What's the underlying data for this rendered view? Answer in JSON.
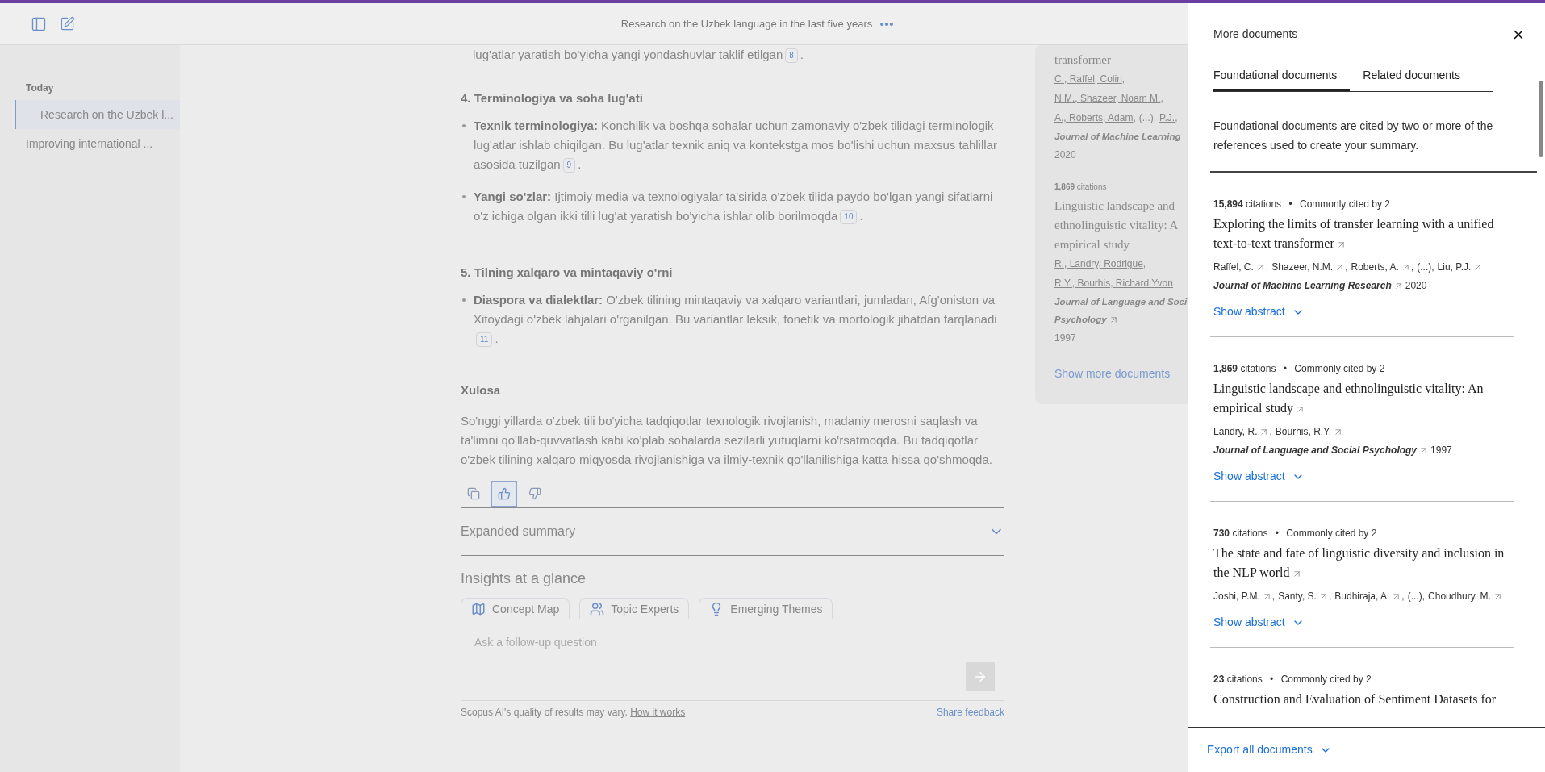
{
  "header": {
    "title": "Research on the Uzbek language in the last five years"
  },
  "sidebar": {
    "section": "Today",
    "items": [
      {
        "label": "Research on the Uzbek l...",
        "selected": true
      },
      {
        "label": "Improving international ...",
        "selected": false
      }
    ]
  },
  "content": {
    "intro": {
      "text": "lug'atlar yaratish bo'yicha yangi yondashuvlar taklif etilgan",
      "ref": "8",
      "end": "."
    },
    "sections": [
      {
        "heading": "4. Terminologiya va soha lug'ati",
        "bullets": [
          {
            "term": "Texnik terminologiya:",
            "text": "Konchilik va boshqa sohalar uchun zamonaviy o'zbek tilidagi terminologik lug'atlar ishlab chiqilgan. Bu lug'atlar texnik aniq va kontekstga mos bo'lishi uchun maxsus tahlillar asosida tuzilgan",
            "ref": "9",
            "end": "."
          },
          {
            "term": "Yangi so'zlar:",
            "text": "Ijtimoiy media va texnologiyalar ta'sirida o'zbek tilida paydo bo'lgan yangi sifatlarni o'z ichiga olgan ikki tilli lug'at yaratish bo'yicha ishlar olib borilmoqda",
            "ref": "10",
            "end": "."
          }
        ]
      },
      {
        "heading": "5. Tilning xalqaro va mintaqaviy o'rni",
        "bullets": [
          {
            "term": "Diaspora va dialektlar:",
            "text": "O'zbek tilining mintaqaviy va xalqaro variantlari, jumladan, Afg'oniston va Xitoydagi o'zbek lahjalari o'rganilgan. Bu variantlar leksik, fonetik va morfologik jihatdan farqlanadi",
            "ref": "11",
            "end": "."
          }
        ]
      }
    ],
    "conclusion": {
      "heading": "Xulosa",
      "text": "So'nggi yillarda o'zbek tili bo'yicha tadqiqotlar texnologik rivojlanish, madaniy merosni saqlash va ta'limni qo'llab-quvvatlash kabi ko'plab sohalarda sezilarli yutuqlarni ko'rsatmoqda. Bu tadqiqotlar o'zbek tilining xalqaro miqyosda rivojlanishiga va ilmiy-texnik qo'llanilishiga katta hissa qo'shmoqda."
    },
    "feedback": [
      {
        "kind": "copy",
        "selected": false
      },
      {
        "kind": "like",
        "selected": true
      },
      {
        "kind": "dislike",
        "selected": false
      }
    ],
    "expanded_summary": {
      "label": "Expanded summary",
      "expanded": false
    },
    "insights": {
      "title": "Insights at a glance",
      "tabs": [
        {
          "kind": "map",
          "label": "Concept Map"
        },
        {
          "kind": "experts",
          "label": "Topic Experts"
        },
        {
          "kind": "themes",
          "label": "Emerging Themes"
        }
      ]
    },
    "followup": {
      "placeholder": "Ask a follow-up question"
    },
    "footer": {
      "disclaimer": "Scopus AI's quality of results may vary.",
      "link": "How it works",
      "feedback": "Share feedback"
    }
  },
  "references": {
    "items": [
      {
        "title_lines": [
          "transformer"
        ],
        "author_lines": [
          [
            {
              "kind": "link",
              "text": "C., Raffel, Colin",
              "sep": ","
            }
          ],
          [
            {
              "kind": "link",
              "text": "N.M., Shazeer, Noam M.",
              "sep": ","
            }
          ],
          [
            {
              "kind": "link",
              "text": "A., Roberts, Adam",
              "sep": ","
            },
            {
              "kind": "text",
              "text": "(...)",
              "sep": ","
            },
            {
              "kind": "link",
              "text": "P.J.",
              "sep": ","
            }
          ]
        ],
        "journal_lines": [
          "Journal of Machine Learning"
        ],
        "year": "2020"
      },
      {
        "citations": "1,869",
        "citations_label": "citations",
        "title_lines": [
          "Linguistic landscape and",
          "ethnolinguistic vitality: A",
          "empirical study"
        ],
        "author_lines": [
          [
            {
              "kind": "link",
              "text": "R., Landry, Rodrigue",
              "sep": ","
            }
          ],
          [
            {
              "kind": "link",
              "text": "R.Y., Bourhis, Richard Yvon"
            }
          ]
        ],
        "journal_lines": [
          "Journal of Language and Soci",
          "Psychology"
        ],
        "year": "1997"
      }
    ],
    "more": "Show more documents"
  },
  "panel": {
    "title": "More documents",
    "tabs": [
      {
        "label": "Foundational documents",
        "selected": true
      },
      {
        "label": "Related documents",
        "selected": false
      }
    ],
    "description": "Foundational documents are cited by two or more of the references used to create your summary.",
    "documents": [
      {
        "citations": "15,894",
        "citations_label": "citations",
        "cited_by": "Commonly cited by 2",
        "title": "Exploring the limits of transfer learning with a unified text-to-text transformer",
        "separator": "•",
        "authors": [
          {
            "kind": "link",
            "text": "Raffel, C.",
            "sep": ","
          },
          {
            "kind": "link",
            "text": "Shazeer, N.M.",
            "sep": ","
          },
          {
            "kind": "link",
            "text": "Roberts, A.",
            "sep": ","
          },
          {
            "kind": "text",
            "text": "(...)",
            "sep": ","
          },
          {
            "kind": "link",
            "text": "Liu, P.J."
          }
        ],
        "journal": "Journal of Machine Learning Research",
        "year": "2020",
        "abstract": "Show abstract"
      },
      {
        "citations": "1,869",
        "citations_label": "citations",
        "cited_by": "Commonly cited by 2",
        "title": "Linguistic landscape and ethnolinguistic vitality: An empirical study",
        "separator": "•",
        "authors": [
          {
            "kind": "link",
            "text": "Landry, R.",
            "sep": ","
          },
          {
            "kind": "link",
            "text": "Bourhis, R.Y."
          }
        ],
        "journal": "Journal of Language and Social Psychology",
        "year": "1997",
        "abstract": "Show abstract"
      },
      {
        "citations": "730",
        "citations_label": "citations",
        "cited_by": "Commonly cited by 2",
        "title": "The state and fate of linguistic diversity and inclusion in the NLP world",
        "separator": "•",
        "authors": [
          {
            "kind": "link",
            "text": "Joshi, P.M.",
            "sep": ","
          },
          {
            "kind": "link",
            "text": "Santy, S.",
            "sep": ","
          },
          {
            "kind": "link",
            "text": "Budhiraja, A.",
            "sep": ","
          },
          {
            "kind": "text",
            "text": "(...)",
            "sep": ","
          },
          {
            "kind": "link",
            "text": "Choudhury, M."
          }
        ],
        "abstract": "Show abstract"
      },
      {
        "citations": "23",
        "citations_label": "citations",
        "separator": "•",
        "cited_by": "Commonly cited by 2",
        "title": "Construction and Evaluation of Sentiment Datasets for"
      }
    ],
    "export": "Export all documents"
  }
}
